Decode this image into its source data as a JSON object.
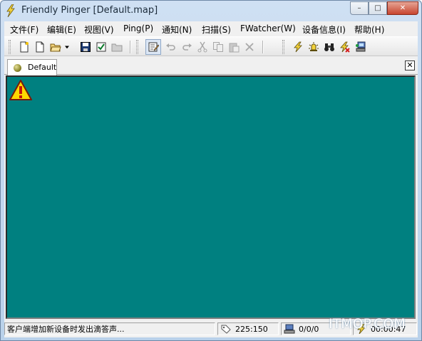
{
  "window": {
    "title": "Friendly Pinger [Default.map]",
    "caption_buttons": {
      "minimize": "–",
      "maximize": "□",
      "close": "✕"
    }
  },
  "menu": {
    "items": [
      {
        "label": "文件(F)"
      },
      {
        "label": "编辑(E)"
      },
      {
        "label": "视图(V)"
      },
      {
        "label": "Ping(P)"
      },
      {
        "label": "通知(N)"
      },
      {
        "label": "扫描(S)"
      },
      {
        "label": "FWatcher(W)"
      },
      {
        "label": "设备信息(I)"
      },
      {
        "label": "帮助(H)"
      }
    ]
  },
  "toolbar": {
    "buttons": [
      {
        "icon": "new-map-icon"
      },
      {
        "icon": "new-document-icon"
      },
      {
        "icon": "open-folder-icon"
      },
      {
        "icon": "dropdown-arrow-icon"
      },
      {
        "icon": "save-icon"
      },
      {
        "icon": "checklist-icon"
      },
      {
        "icon": "folder-disabled-icon"
      },
      {
        "icon": "edit-mode-icon",
        "pressed": true
      },
      {
        "icon": "undo-icon"
      },
      {
        "icon": "redo-icon"
      },
      {
        "icon": "cut-icon"
      },
      {
        "icon": "copy-icon"
      },
      {
        "icon": "paste-icon"
      },
      {
        "icon": "delete-icon"
      },
      {
        "icon": "ping-lightning-icon"
      },
      {
        "icon": "alarm-icon"
      },
      {
        "icon": "binoculars-icon"
      },
      {
        "icon": "stop-ping-icon"
      },
      {
        "icon": "computer-settings-icon"
      }
    ]
  },
  "tabs": [
    {
      "label": "Default",
      "active": true
    }
  ],
  "tab_close_glyph": "✕",
  "map": {
    "background_color": "#008080"
  },
  "status": {
    "message": "客户端增加新设备时发出滴答声...",
    "coordinates": "225:150",
    "counts": "0/0/0",
    "timer": "00:00:47"
  },
  "watermark": "ITMOP.COM"
}
